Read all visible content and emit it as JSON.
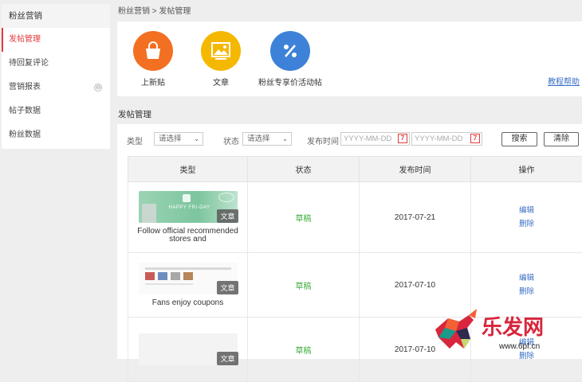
{
  "sidebar": {
    "title": "粉丝营销",
    "items": [
      {
        "label": "发帖管理",
        "active": true
      },
      {
        "label": "待回复评论"
      },
      {
        "label": "营销报表",
        "collapse_symbol": "⊖"
      },
      {
        "label": "帖子数据"
      },
      {
        "label": "粉丝数据"
      }
    ]
  },
  "breadcrumb": "粉丝营销 > 发帖管理",
  "quick_actions": [
    {
      "label": "上新贴",
      "icon": "shopping-bag-icon",
      "color": "#f36f21"
    },
    {
      "label": "文章",
      "icon": "image-icon",
      "color": "#f5b800"
    },
    {
      "label": "粉丝专享价活动帖",
      "icon": "percent-icon",
      "color": "#3d82d8"
    }
  ],
  "help_link": "教程帮助",
  "section_title": "发帖管理",
  "filters": {
    "type_label": "类型",
    "type_value": "请选择",
    "status_label": "状态",
    "status_value": "请选择",
    "time_label": "发布时间",
    "date_placeholder": "YYYY-MM-DD",
    "calendar_glyph": "7",
    "search_button": "搜索",
    "clear_button": "清除"
  },
  "table": {
    "columns": [
      "类型",
      "状态",
      "发布时间",
      "操作"
    ],
    "rows": [
      {
        "badge": "文章",
        "thumb_text": "HAPPY FRI-DAY",
        "title": "Follow official recommended stores and",
        "status": "草稿",
        "date": "2017-07-21",
        "actions": [
          "编辑",
          "删除"
        ]
      },
      {
        "badge": "文章",
        "title": "Fans enjoy coupons",
        "status": "草稿",
        "date": "2017-07-10",
        "actions": [
          "编辑",
          "删除"
        ]
      },
      {
        "badge": "文章",
        "status": "草稿",
        "date": "2017-07-10",
        "actions": [
          "编辑",
          "删除"
        ]
      }
    ]
  },
  "watermark": {
    "brand": "乐发网",
    "url": "www.6pf.cn"
  },
  "colors": {
    "accent_red": "#e4393c",
    "status_green": "#3fae3f",
    "link_blue": "#3a6fc4"
  }
}
